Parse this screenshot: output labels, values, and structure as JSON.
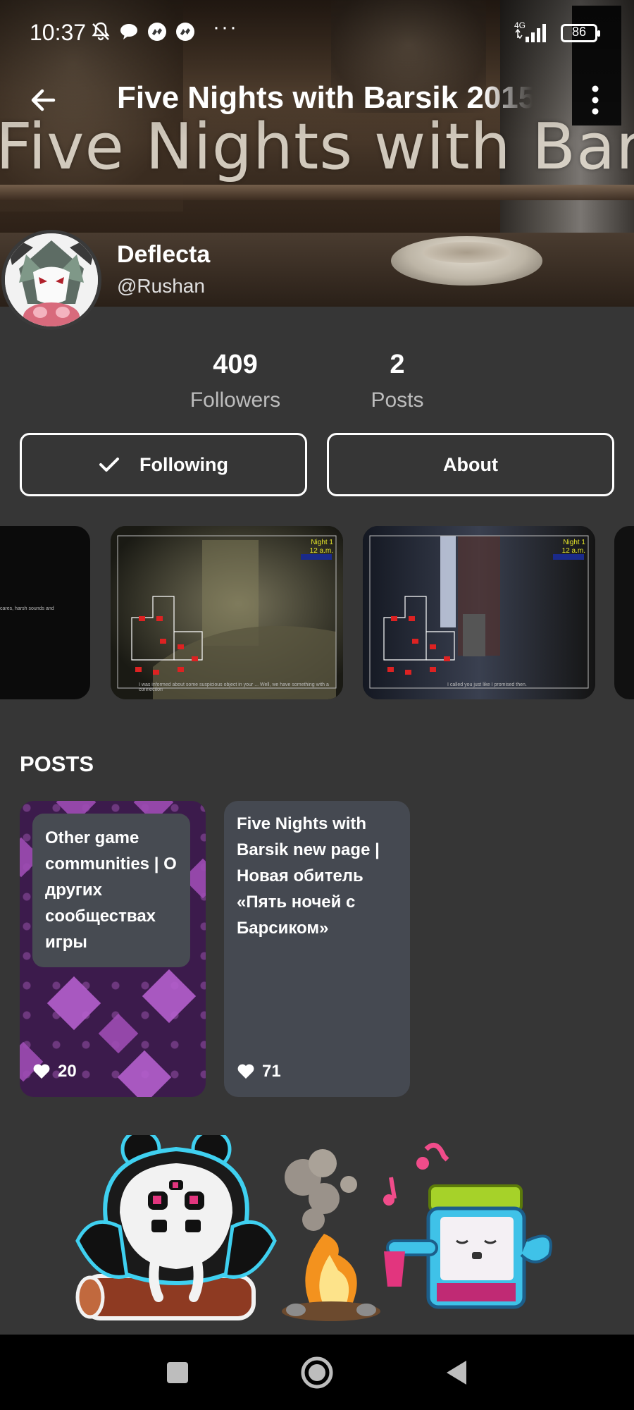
{
  "status_bar": {
    "time": "10:37",
    "battery": "86",
    "network": "4G",
    "icons": [
      "bell-off-icon",
      "chat-bubble-icon",
      "messenger-icon",
      "messenger-icon"
    ],
    "more_dots": "···"
  },
  "banner": {
    "background_text": "Five Nights with Barsik"
  },
  "toolbar": {
    "title": "Five Nights with Barsik 2015",
    "back_icon": "arrow-left-icon",
    "menu_icon": "more-vertical-icon"
  },
  "profile": {
    "name": "Deflecta",
    "handle": "@Rushan"
  },
  "stats": {
    "followers_count": "409",
    "followers_label": "Followers",
    "posts_count": "2",
    "posts_label": "Posts"
  },
  "actions": {
    "following_label": "Following",
    "about_label": "About"
  },
  "gallery": {
    "items": [
      {
        "night": "",
        "caption": "cares, harsh sounds and"
      },
      {
        "night": "Night 1\n12 a.m.",
        "caption": "I was informed about some suspicious object in your ... Well, we have something with a connection"
      },
      {
        "night": "Night 1\n12 a.m.",
        "caption": "I called you just like I promised then."
      }
    ]
  },
  "posts_section": {
    "heading": "POSTS",
    "posts": [
      {
        "title": "Other game communities | О других сообществах игры",
        "likes": "20"
      },
      {
        "title": "Five Nights with Barsik new page | Новая обитель «Пять ночей с Барсиком»",
        "likes": "71"
      }
    ]
  },
  "colors": {
    "background": "#363636",
    "card_gray": "#454951",
    "card_purple": "#3c1b4c",
    "nav_bar": "#000000"
  }
}
